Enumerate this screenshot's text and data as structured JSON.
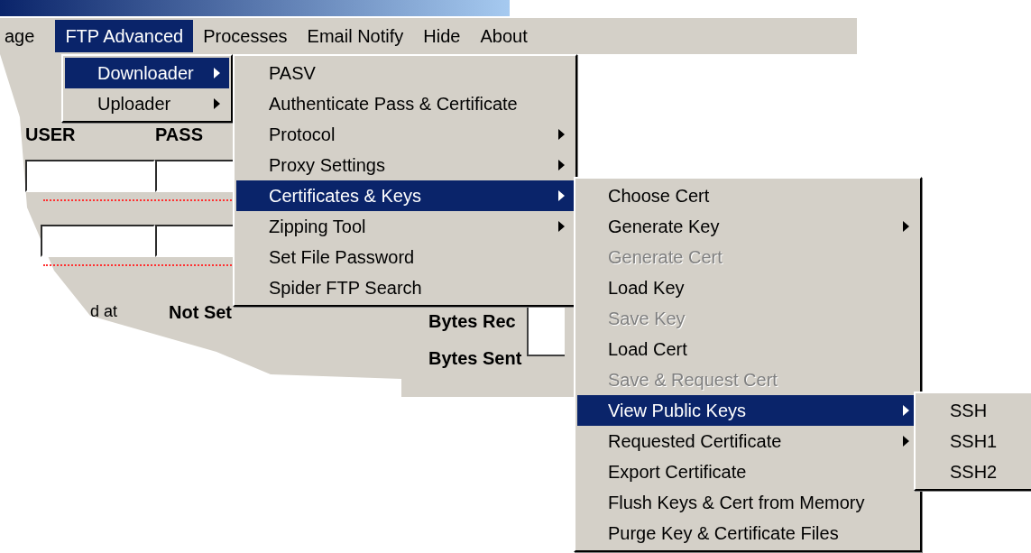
{
  "menu_bar": [
    {
      "label": "age",
      "selected": false
    },
    {
      "label": "FTP Advanced",
      "selected": true
    },
    {
      "label": "Processes",
      "selected": false
    },
    {
      "label": "Email Notify",
      "selected": false
    },
    {
      "label": "Hide",
      "selected": false
    },
    {
      "label": "About",
      "selected": false
    }
  ],
  "form": {
    "user_label": "USER",
    "pass_label": "PASS",
    "status_label": "d at",
    "status_value": "Not Set",
    "bytes_rec_label": "Bytes Rec",
    "bytes_sent_label": "Bytes Sent"
  },
  "menus": [
    {
      "items": [
        {
          "label": "Downloader",
          "selected": true,
          "submenu": true,
          "disabled": false
        },
        {
          "label": "Uploader",
          "selected": false,
          "submenu": true,
          "disabled": false
        }
      ]
    },
    {
      "items": [
        {
          "label": "PASV",
          "selected": false,
          "submenu": false,
          "disabled": false
        },
        {
          "label": "Authenticate Pass & Certificate",
          "selected": false,
          "submenu": false,
          "disabled": false
        },
        {
          "label": "Protocol",
          "selected": false,
          "submenu": true,
          "disabled": false
        },
        {
          "label": "Proxy Settings",
          "selected": false,
          "submenu": true,
          "disabled": false
        },
        {
          "label": "Certificates & Keys",
          "selected": true,
          "submenu": true,
          "disabled": false
        },
        {
          "label": "Zipping Tool",
          "selected": false,
          "submenu": true,
          "disabled": false
        },
        {
          "label": "Set File Password",
          "selected": false,
          "submenu": false,
          "disabled": false
        },
        {
          "label": "Spider FTP Search",
          "selected": false,
          "submenu": false,
          "disabled": false
        }
      ]
    },
    {
      "items": [
        {
          "label": "Choose Cert",
          "selected": false,
          "submenu": false,
          "disabled": false
        },
        {
          "label": "Generate Key",
          "selected": false,
          "submenu": true,
          "disabled": false
        },
        {
          "label": "Generate Cert",
          "selected": false,
          "submenu": false,
          "disabled": true
        },
        {
          "label": "Load Key",
          "selected": false,
          "submenu": false,
          "disabled": false
        },
        {
          "label": "Save Key",
          "selected": false,
          "submenu": false,
          "disabled": true
        },
        {
          "label": "Load Cert",
          "selected": false,
          "submenu": false,
          "disabled": false
        },
        {
          "label": "Save & Request Cert",
          "selected": false,
          "submenu": false,
          "disabled": true
        },
        {
          "label": "View Public Keys",
          "selected": true,
          "submenu": true,
          "disabled": false
        },
        {
          "label": "Requested Certificate",
          "selected": false,
          "submenu": true,
          "disabled": false
        },
        {
          "label": "Export Certificate",
          "selected": false,
          "submenu": false,
          "disabled": false
        },
        {
          "label": "Flush Keys & Cert from Memory",
          "selected": false,
          "submenu": false,
          "disabled": false
        },
        {
          "label": "Purge Key & Certificate Files",
          "selected": false,
          "submenu": false,
          "disabled": false
        }
      ]
    },
    {
      "items": [
        {
          "label": "SSH",
          "selected": false,
          "submenu": false,
          "disabled": false
        },
        {
          "label": "SSH1",
          "selected": false,
          "submenu": false,
          "disabled": false
        },
        {
          "label": "SSH2",
          "selected": false,
          "submenu": false,
          "disabled": false
        }
      ]
    }
  ]
}
